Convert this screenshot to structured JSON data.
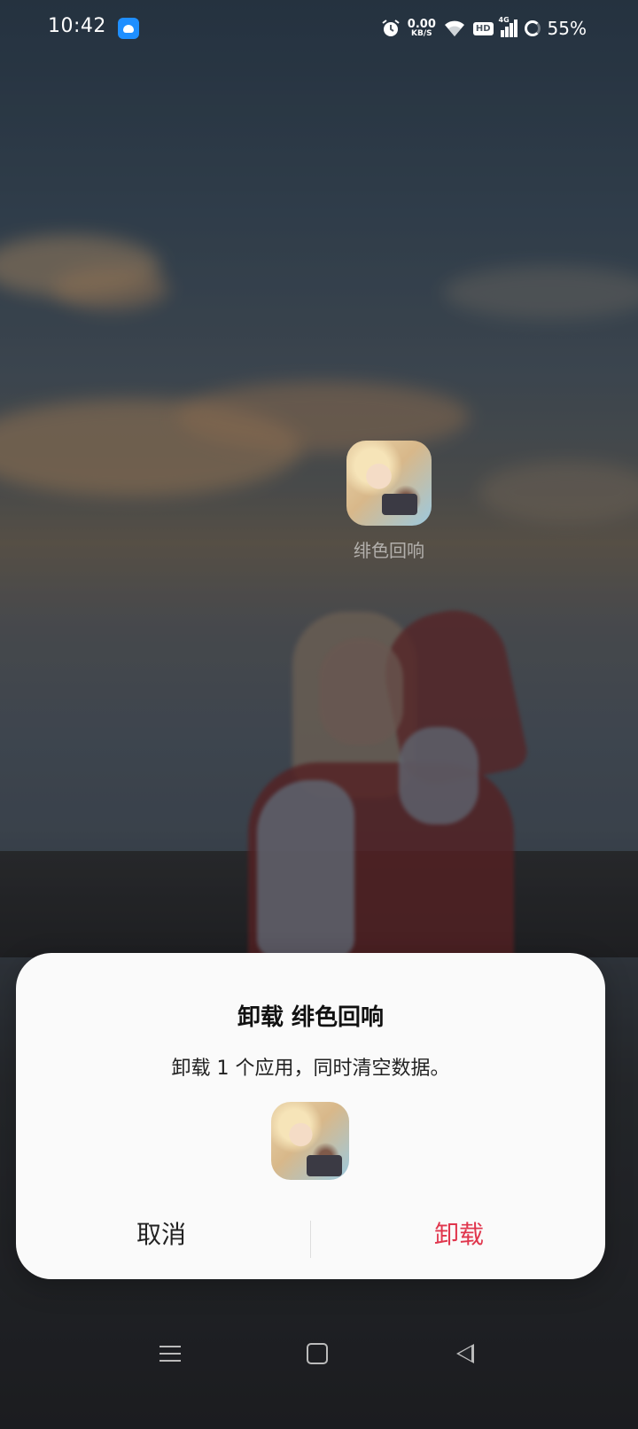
{
  "status_bar": {
    "time": "10:42",
    "speed_value": "0.00",
    "speed_unit": "KB/S",
    "hd_label": "HD",
    "network_label": "4G",
    "battery": "55%"
  },
  "home": {
    "app_label": "绯色回响"
  },
  "dialog": {
    "title": "卸载 绯色回响",
    "message": "卸载 1 个应用，同时清空数据。",
    "cancel_label": "取消",
    "confirm_label": "卸载"
  },
  "colors": {
    "confirm": "#e0364d",
    "dialog_bg": "#fafafa"
  }
}
